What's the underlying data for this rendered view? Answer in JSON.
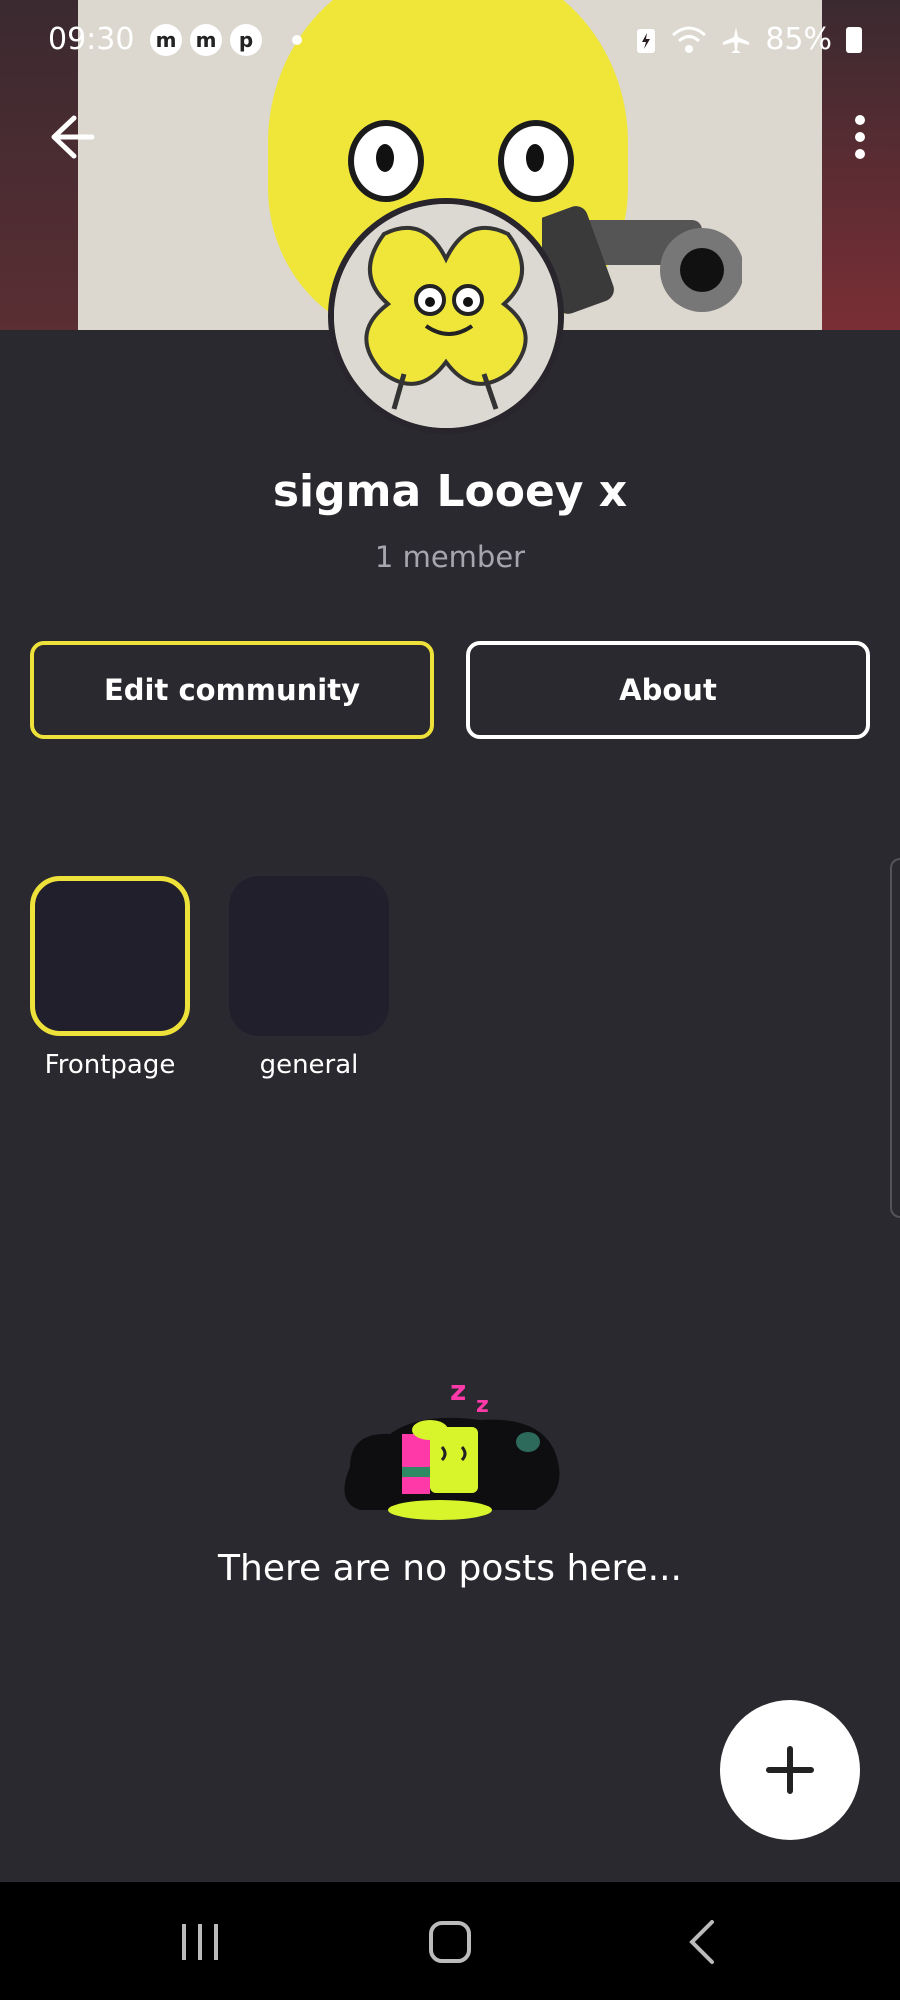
{
  "status_bar": {
    "time": "09:30",
    "battery": "85%",
    "app_icons": [
      "m",
      "m",
      "p"
    ]
  },
  "community": {
    "name": "sigma Looey x",
    "members": "1 member"
  },
  "actions": {
    "edit_label": "Edit community",
    "about_label": "About"
  },
  "channels": [
    {
      "label": "Frontpage",
      "selected": true
    },
    {
      "label": "general",
      "selected": false
    }
  ],
  "empty_state": {
    "message": "There are no posts here..."
  },
  "colors": {
    "accent": "#eee23a",
    "background": "#2a292f",
    "tile": "#221f2c"
  }
}
